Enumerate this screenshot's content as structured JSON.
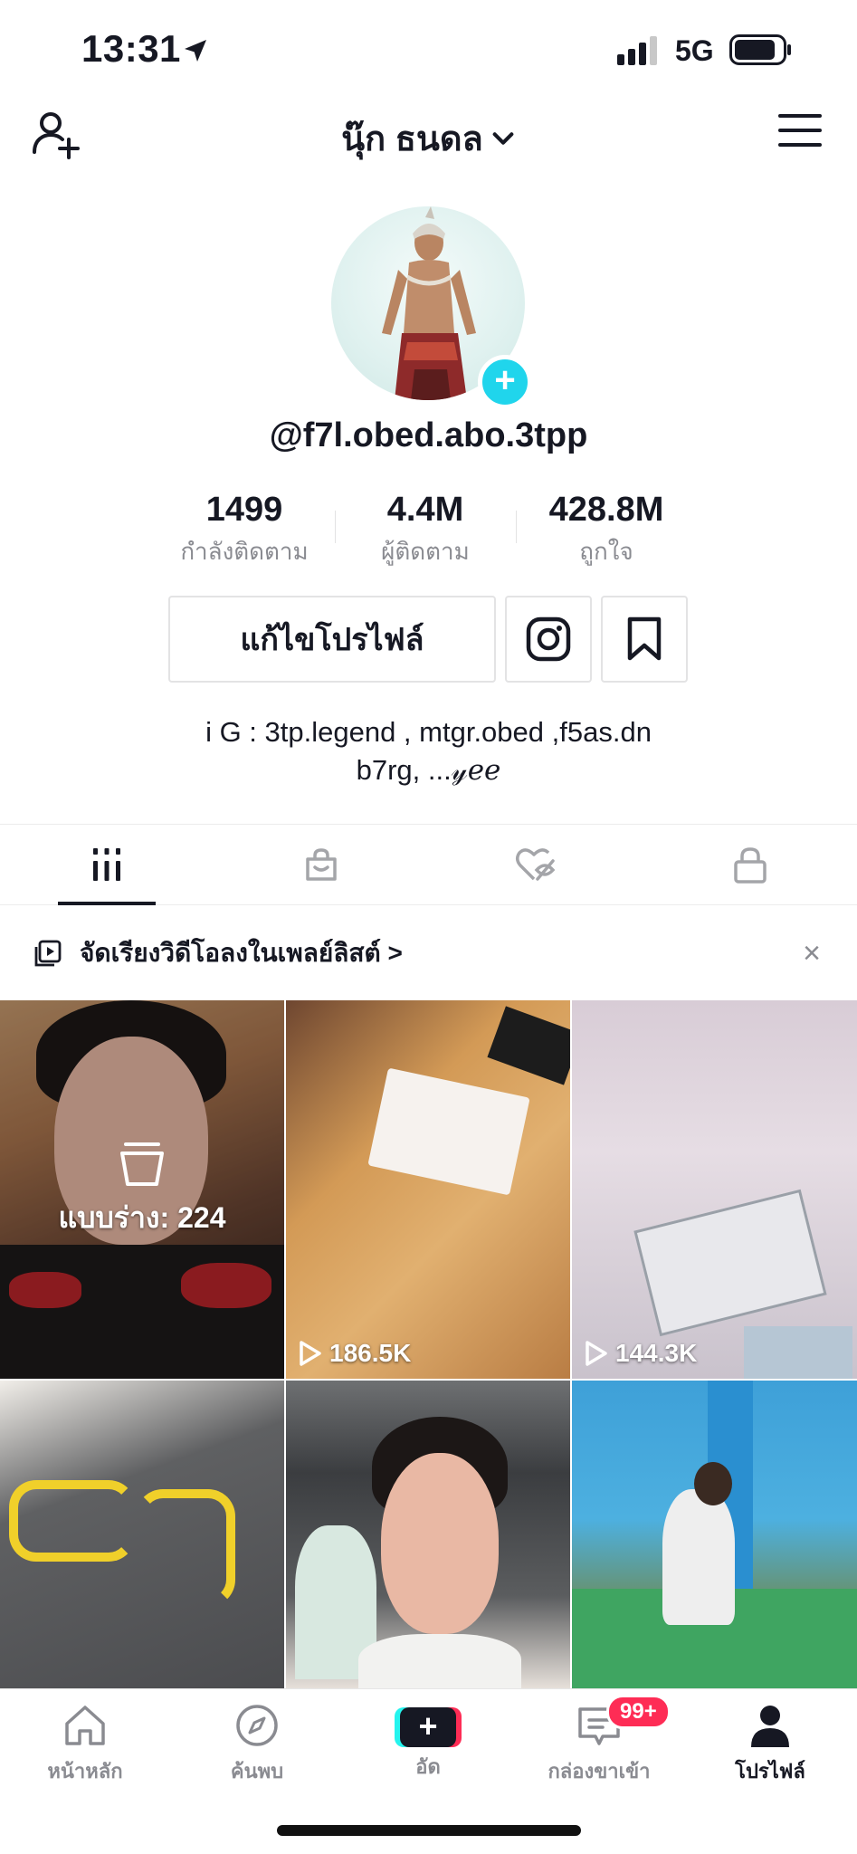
{
  "status_bar": {
    "time": "13:31",
    "network": "5G"
  },
  "header": {
    "profile_name": "นุ๊ก ธนดล"
  },
  "profile": {
    "username": "@f7l.obed.abo.3tpp",
    "stats": [
      {
        "value": "1499",
        "label": "กำลังติดตาม"
      },
      {
        "value": "4.4M",
        "label": "ผู้ติดตาม"
      },
      {
        "value": "428.8M",
        "label": "ถูกใจ"
      }
    ],
    "edit_profile_label": "แก้ไขโปรไฟล์",
    "bio_line1": "i G : 3tp.legend , mtgr.obed ,f5as.dn",
    "bio_line2": "b7rg, ...𝓎ℯℯ"
  },
  "tabs": [
    {
      "icon": "grid-icon",
      "active": true
    },
    {
      "icon": "shopping-bag-icon",
      "active": false
    },
    {
      "icon": "liked-hidden-icon",
      "active": false
    },
    {
      "icon": "lock-icon",
      "active": false
    }
  ],
  "playlist_banner": {
    "text": "จัดเรียงวิดีโอลงในเพลย์ลิสต์ >",
    "close": "×"
  },
  "videos": [
    {
      "type": "draft",
      "label": "แบบร่าง: 224"
    },
    {
      "type": "video",
      "views": "186.5K"
    },
    {
      "type": "video",
      "views": "144.3K"
    },
    {
      "type": "video",
      "views": ""
    },
    {
      "type": "video",
      "views": ""
    },
    {
      "type": "video",
      "views": ""
    }
  ],
  "bottom_nav": {
    "home": "หน้าหลัก",
    "discover": "ค้นพบ",
    "create": "อัด",
    "inbox": "กล่องขาเข้า",
    "inbox_badge": "99+",
    "profile": "โปรไฟล์"
  },
  "colors": {
    "accent_cyan": "#20d5ec",
    "brand_red": "#fe2c55",
    "brand_teal": "#25f4ee",
    "text_dark": "#161823",
    "text_gray": "#8a8b91"
  }
}
